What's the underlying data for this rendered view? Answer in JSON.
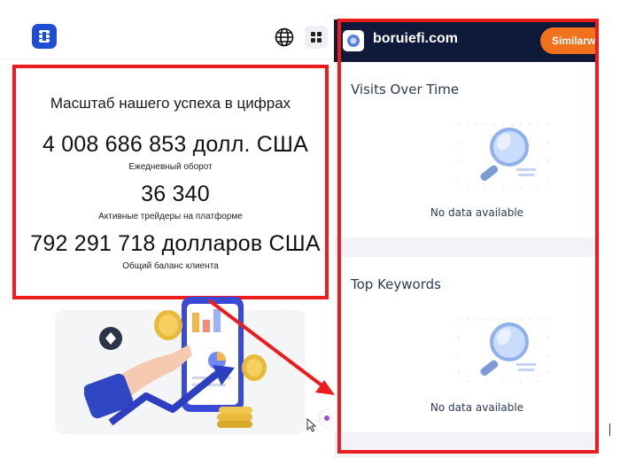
{
  "site": {
    "logo_icon": "app-logo-icon",
    "stats": {
      "title": "Масштаб нашего успеха в цифрах",
      "items": [
        {
          "value": "4 008 686 853 долл. США",
          "label": "Ежедневный оборот"
        },
        {
          "value": "36 340",
          "label": "Активные трейдеры на платформе"
        },
        {
          "value": "792 291 718 долларов США",
          "label": "Общий баланс клиента"
        }
      ]
    }
  },
  "extension": {
    "domain": "boruiefi.com",
    "cta_label": "Similarweb",
    "sections": [
      {
        "title": "Visits Over Time",
        "empty_text": "No data available"
      },
      {
        "title": "Top Keywords",
        "empty_text": "No data available"
      }
    ]
  },
  "annotations": {
    "highlight_color": "#ee1c1c"
  },
  "colors": {
    "brand_blue": "#1f4fd1",
    "ext_header": "#0f1a3a",
    "cta_orange": "#f2711c"
  }
}
